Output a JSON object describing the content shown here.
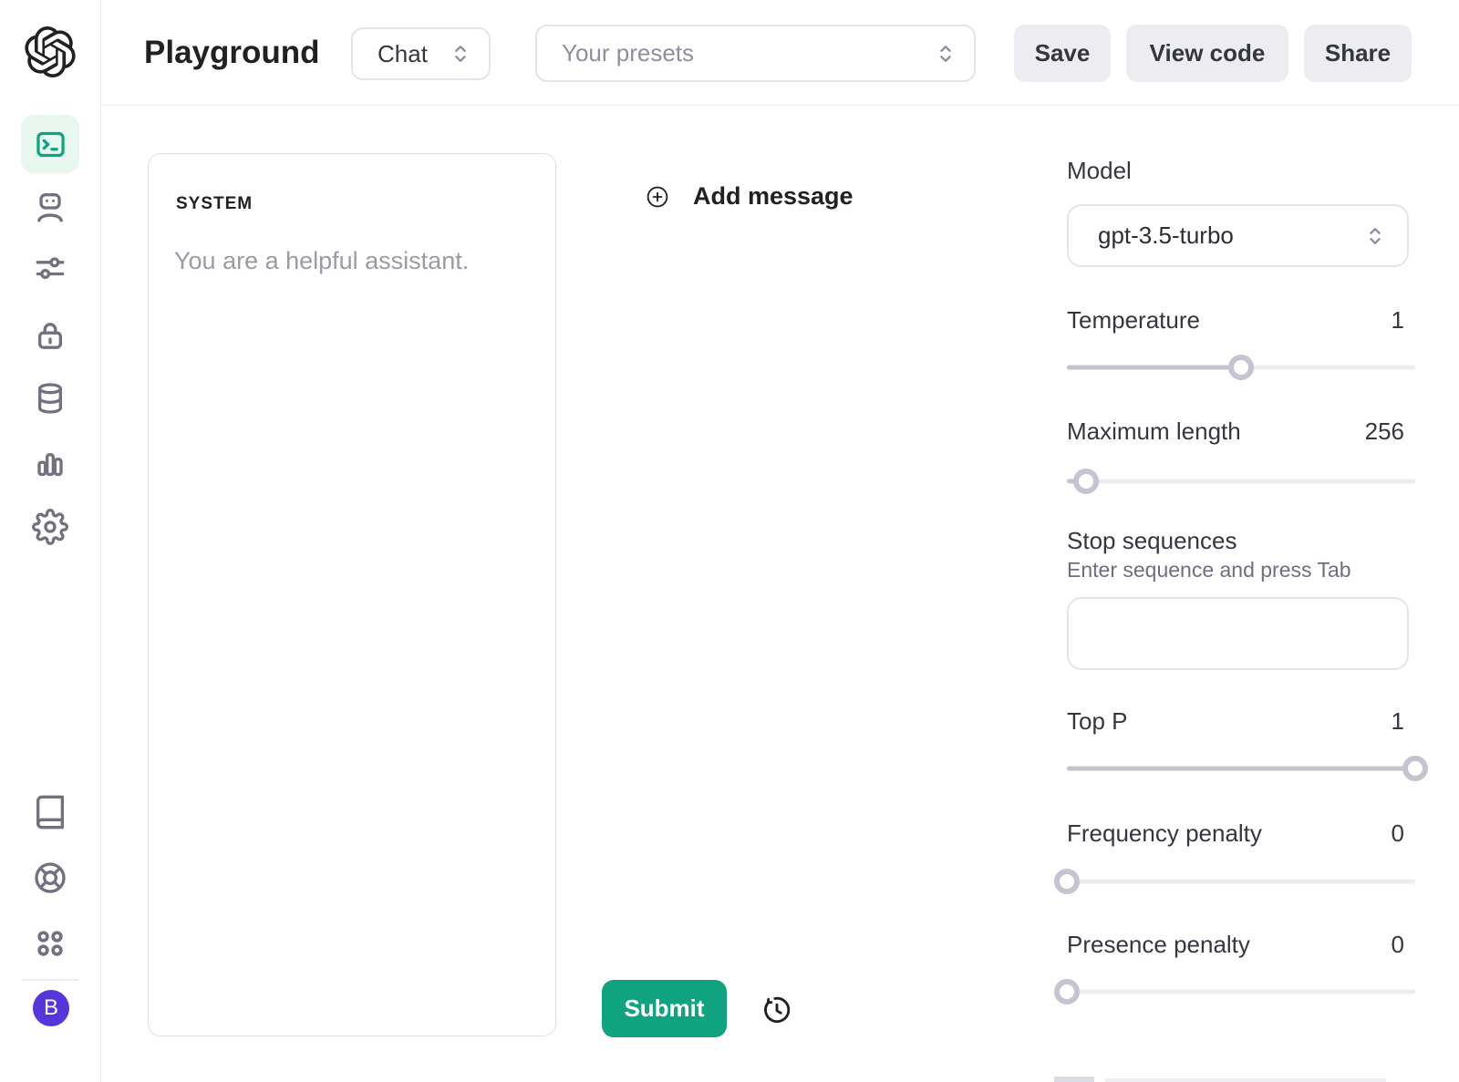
{
  "header": {
    "title": "Playground",
    "mode_select": {
      "value": "Chat",
      "icon": "chevron-updown-icon"
    },
    "presets_select": {
      "placeholder": "Your presets",
      "icon": "chevron-updown-icon"
    },
    "save_label": "Save",
    "view_code_label": "View code",
    "share_label": "Share"
  },
  "sidebar": {
    "logo_icon": "openai-logo",
    "nav_items": [
      {
        "name": "playground",
        "icon": "terminal-icon",
        "active": true
      },
      {
        "name": "assistants",
        "icon": "robot-icon",
        "active": false
      },
      {
        "name": "fine-tuning",
        "icon": "sliders-icon",
        "active": false
      },
      {
        "name": "api-keys",
        "icon": "lock-icon",
        "active": false
      },
      {
        "name": "storage",
        "icon": "database-icon",
        "active": false
      },
      {
        "name": "usage",
        "icon": "bar-chart-icon",
        "active": false
      },
      {
        "name": "settings",
        "icon": "gear-icon",
        "active": false
      }
    ],
    "footer_items": [
      {
        "name": "docs",
        "icon": "book-icon"
      },
      {
        "name": "help",
        "icon": "lifebuoy-icon"
      },
      {
        "name": "apps",
        "icon": "grid-dots-icon"
      }
    ],
    "avatar": {
      "initial": "B",
      "color": "#5436da"
    }
  },
  "system_panel": {
    "label": "SYSTEM",
    "placeholder": "You are a helpful assistant."
  },
  "messages": {
    "add_label": "Add message",
    "add_icon": "plus-circle-icon",
    "submit_label": "Submit",
    "history_icon": "history-icon"
  },
  "params": {
    "model": {
      "label": "Model",
      "value": "gpt-3.5-turbo"
    },
    "temperature": {
      "label": "Temperature",
      "value": "1",
      "fill": "50%"
    },
    "maximum_length": {
      "label": "Maximum length",
      "value": "256",
      "fill": "5.5%"
    },
    "stop_sequences": {
      "label": "Stop sequences",
      "hint": "Enter sequence and press Tab",
      "value": ""
    },
    "top_p": {
      "label": "Top P",
      "value": "1",
      "fill": "100%"
    },
    "frequency_penalty": {
      "label": "Frequency penalty",
      "value": "0",
      "fill": "0%"
    },
    "presence_penalty": {
      "label": "Presence penalty",
      "value": "0",
      "fill": "0%"
    }
  },
  "colors": {
    "brand_green": "#10a37f",
    "active_tile_bg": "#e8f7f0",
    "avatar_purple": "#5436da",
    "slider_fill": "#c5c5d2",
    "slider_track": "#ececf1",
    "border_light": "#ececf1"
  }
}
